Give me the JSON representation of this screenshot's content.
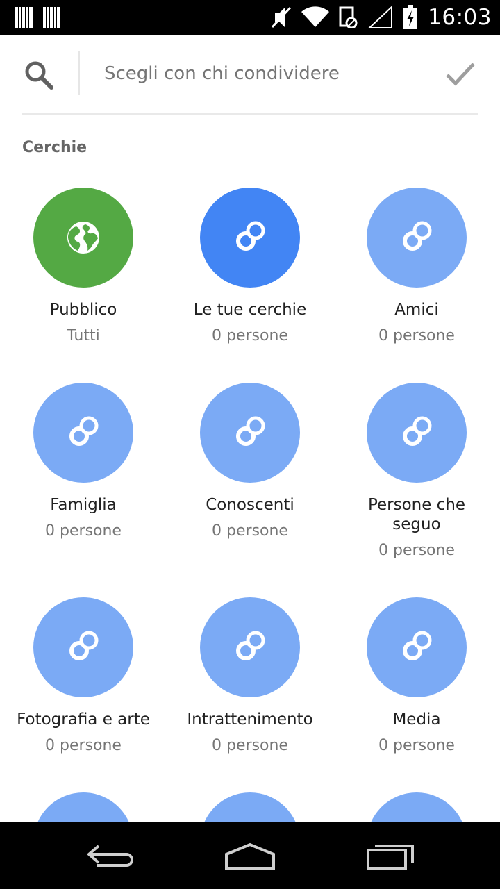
{
  "status_bar": {
    "time": "16:03",
    "icons": [
      "barcode-icon",
      "barcode-icon",
      "mute-icon",
      "wifi-icon",
      "sync-off-icon",
      "signal-icon",
      "battery-charging-icon"
    ]
  },
  "search": {
    "placeholder": "Scegli con chi condividere",
    "value": ""
  },
  "section": {
    "title": "Cerchie"
  },
  "circles": [
    {
      "name": "Pubblico",
      "sub": "Tutti",
      "icon": "globe-icon",
      "color": "#54a944"
    },
    {
      "name": "Le tue cerchie",
      "sub": "0 persone",
      "icon": "circles-icon",
      "color": "#4285f4"
    },
    {
      "name": "Amici",
      "sub": "0 persone",
      "icon": "circles-icon",
      "color": "#7baaf5"
    },
    {
      "name": "Famiglia",
      "sub": "0 persone",
      "icon": "circles-icon",
      "color": "#7baaf5"
    },
    {
      "name": "Conoscenti",
      "sub": "0 persone",
      "icon": "circles-icon",
      "color": "#7baaf5"
    },
    {
      "name": "Persone che seguo",
      "sub": "0 persone",
      "icon": "circles-icon",
      "color": "#7baaf5"
    },
    {
      "name": "Fotografia e arte",
      "sub": "0 persone",
      "icon": "circles-icon",
      "color": "#7baaf5"
    },
    {
      "name": "Intrattenimento",
      "sub": "0 persone",
      "icon": "circles-icon",
      "color": "#7baaf5"
    },
    {
      "name": "Media",
      "sub": "0 persone",
      "icon": "circles-icon",
      "color": "#7baaf5"
    }
  ],
  "nav_bar": {
    "icons": [
      "back-icon",
      "home-icon",
      "recent-apps-icon"
    ]
  }
}
